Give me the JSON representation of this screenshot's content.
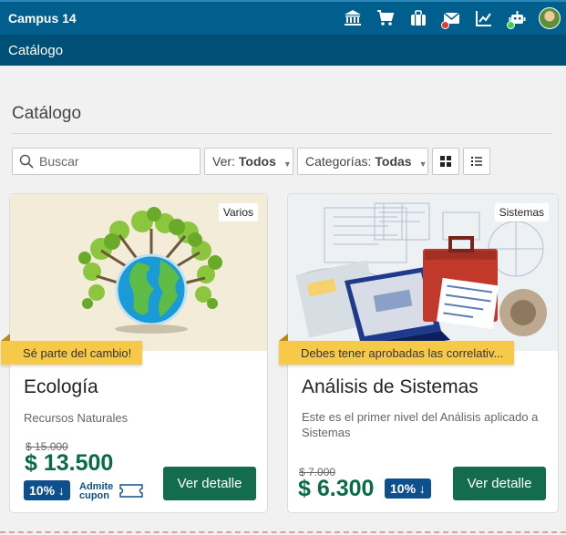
{
  "app": {
    "brand": "Campus 14"
  },
  "topbar": {
    "icons": [
      "bank-icon",
      "cart-icon",
      "briefcase-icon",
      "mail-icon",
      "chart-icon",
      "robot-icon",
      "avatar"
    ]
  },
  "subbar": {
    "title": "Catálogo"
  },
  "page": {
    "title": "Catálogo"
  },
  "filters": {
    "search_placeholder": "Buscar",
    "view_label": "Ver:",
    "view_value": "Todos",
    "category_label": "Categorías:",
    "category_value": "Todas"
  },
  "cards": [
    {
      "badge": "Varios",
      "ribbon": "Sé parte del cambio!",
      "title": "Ecología",
      "subtitle": "Recursos Naturales",
      "old_price": "$ 15.000",
      "price": "$ 13.500",
      "discount": "10% ↓",
      "coupon_line1": "Admite",
      "coupon_line2": "cupon",
      "button": "Ver detalle"
    },
    {
      "badge": "Sistemas",
      "ribbon": "Debes tener aprobadas las correlativ...",
      "title": "Análisis de Sistemas",
      "subtitle": "Este es el primer nivel del Análisis aplicado a Sistemas",
      "old_price": "$ 7.000",
      "price": "$ 6.300",
      "discount": "10% ↓",
      "button": "Ver detalle"
    }
  ],
  "colors": {
    "topbar": "#005f8d",
    "subbar": "#004f76",
    "price": "#0a6b4a",
    "button": "#136c4e",
    "discount": "#0e4f8e",
    "ribbon": "#f7c948"
  }
}
